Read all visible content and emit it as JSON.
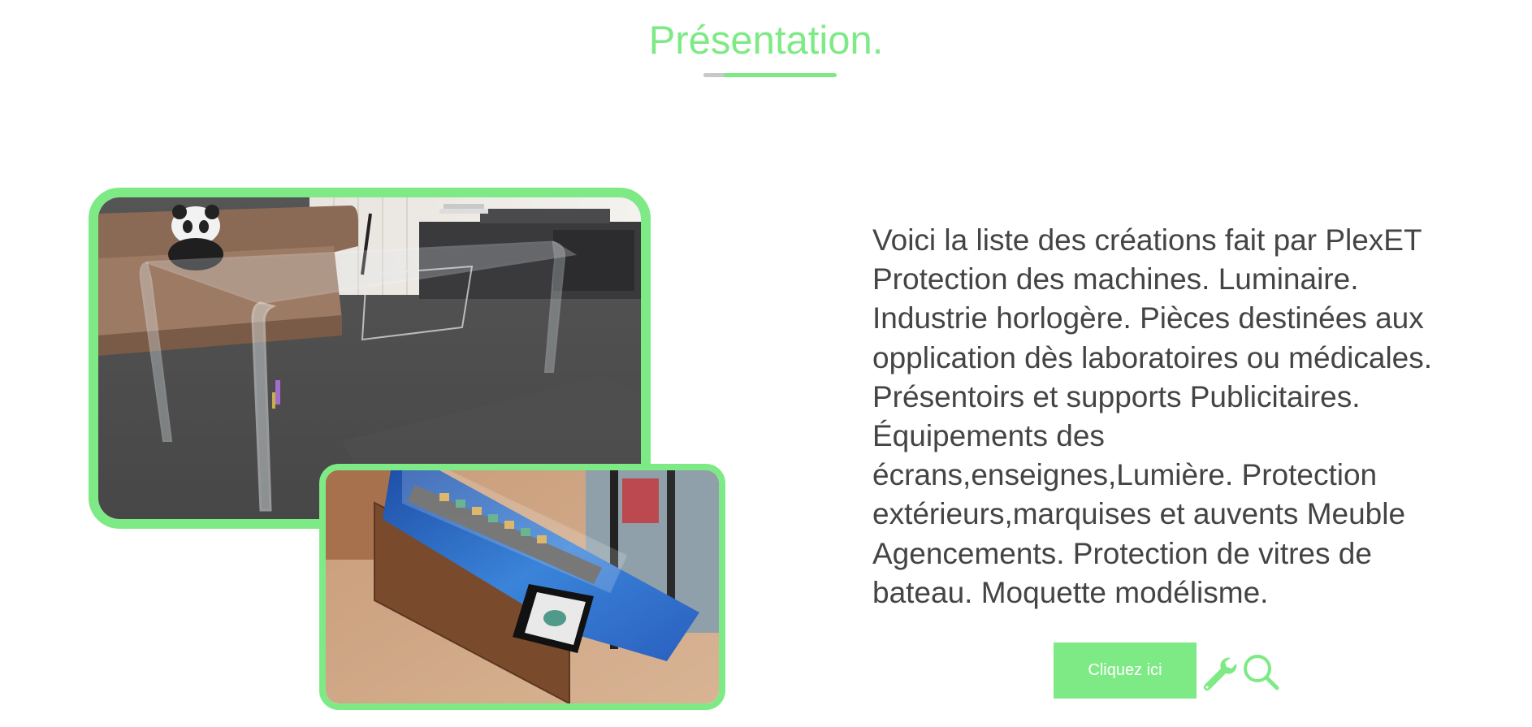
{
  "section": {
    "title": "Présentation."
  },
  "images": {
    "primary": "acrylic-coffee-table-photo",
    "secondary": "acrylic-ship-display-case-photo"
  },
  "description": {
    "text": "Voici la liste des créations fait par PlexET Protection des machines. Luminaire. Industrie horlogère. Pièces destinées aux opplication dès laboratoires ou médicales. Présentoirs et supports Publicitaires. Équipements des écrans,enseignes,Lumière. Protection extérieurs,marquises et auvents Meuble Agencements. Protection de vitres de bateau. Moquette modélisme."
  },
  "cta": {
    "label": "Cliquez ici"
  },
  "icons": {
    "tool": "wrench-icon",
    "search": "search-icon"
  },
  "colors": {
    "accent": "#7eea85",
    "text": "#444444",
    "background": "#ffffff"
  }
}
